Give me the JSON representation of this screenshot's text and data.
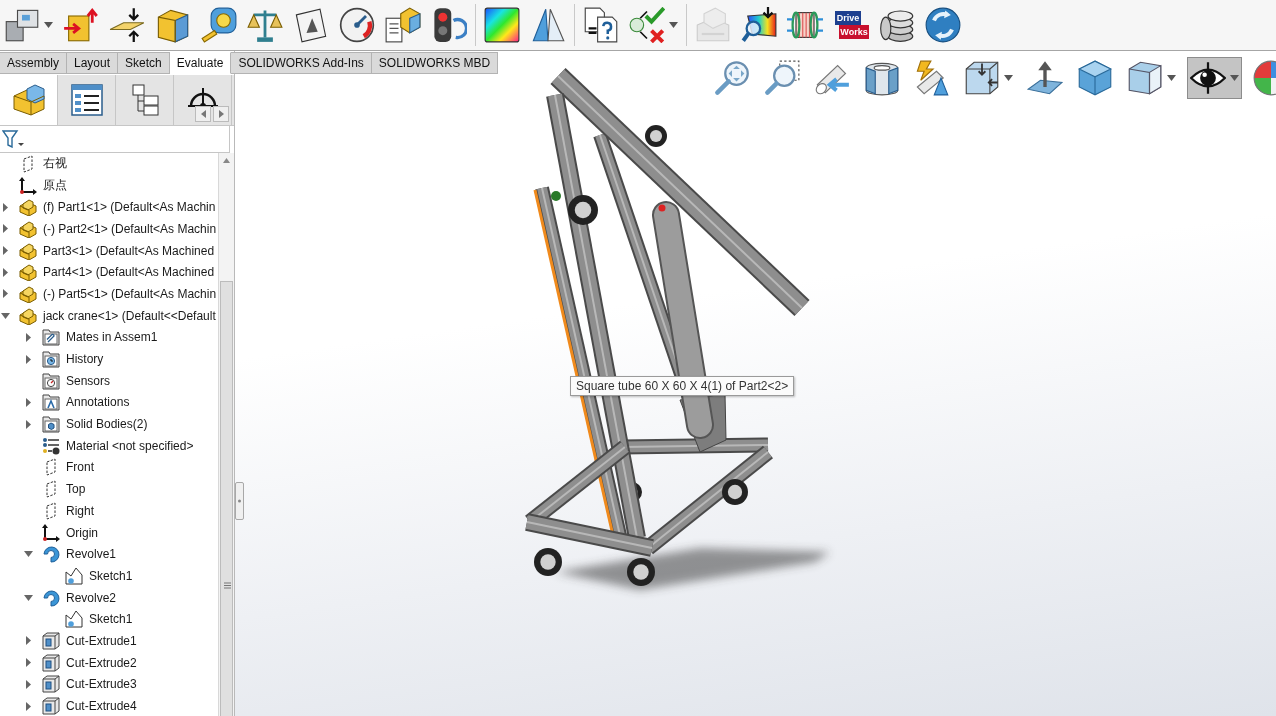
{
  "command_manager": {
    "groups": [
      {
        "buttons": [
          {
            "dropdown": true,
            "disabled": false
          },
          {
            "dropdown": false,
            "disabled": false
          },
          {
            "dropdown": false,
            "disabled": false
          },
          {
            "dropdown": false,
            "disabled": false
          },
          {
            "dropdown": false,
            "disabled": false
          },
          {
            "dropdown": false,
            "disabled": false
          },
          {
            "dropdown": false,
            "disabled": false
          },
          {
            "dropdown": false,
            "disabled": false
          },
          {
            "dropdown": false,
            "disabled": false
          },
          {
            "dropdown": false,
            "disabled": false
          }
        ]
      },
      {
        "buttons": [
          {
            "dropdown": false,
            "disabled": false
          },
          {
            "dropdown": false,
            "disabled": false
          }
        ]
      },
      {
        "buttons": [
          {
            "dropdown": false,
            "disabled": false
          },
          {
            "dropdown": true,
            "disabled": false
          }
        ]
      },
      {
        "buttons": [
          {
            "dropdown": false,
            "disabled": true
          },
          {
            "dropdown": false,
            "disabled": false
          },
          {
            "dropdown": false,
            "disabled": false
          },
          {
            "dropdown": false,
            "disabled": false,
            "label_lines": [
              "Drive",
              "Works"
            ]
          },
          {
            "dropdown": false,
            "disabled": false
          },
          {
            "dropdown": false,
            "disabled": false
          }
        ]
      }
    ]
  },
  "tabs": [
    {
      "label": "Assembly",
      "selected": false
    },
    {
      "label": "Layout",
      "selected": false
    },
    {
      "label": "Sketch",
      "selected": false
    },
    {
      "label": "Evaluate",
      "selected": true
    },
    {
      "label": "SOLIDWORKS Add-Ins",
      "selected": false
    },
    {
      "label": "SOLIDWORKS MBD",
      "selected": false
    }
  ],
  "feature_manager": {
    "tabs": [
      {
        "selected": true
      },
      {
        "selected": false
      },
      {
        "selected": false
      },
      {
        "selected": false
      }
    ],
    "tree": [
      {
        "label": "右视",
        "kind": "plane",
        "expandable": false
      },
      {
        "label": "原点",
        "kind": "origin",
        "expandable": false
      },
      {
        "label": "(f) Part1<1> (Default<As Machin",
        "kind": "part",
        "expandable": true,
        "expanded": false
      },
      {
        "label": "(-) Part2<1> (Default<As Machin",
        "kind": "part",
        "expandable": true,
        "expanded": false
      },
      {
        "label": "Part3<1> (Default<As Machined",
        "kind": "part",
        "expandable": true,
        "expanded": false
      },
      {
        "label": "Part4<1> (Default<As Machined",
        "kind": "part",
        "expandable": true,
        "expanded": false
      },
      {
        "label": "(-) Part5<1> (Default<As Machin",
        "kind": "part",
        "expandable": true,
        "expanded": false
      },
      {
        "label": "jack crane<1> (Default<<Default",
        "kind": "part",
        "expandable": true,
        "expanded": true,
        "children": [
          {
            "label": "Mates in Assem1",
            "kind": "mates-folder",
            "expandable": true,
            "expanded": false
          },
          {
            "label": "History",
            "kind": "history-folder",
            "expandable": true,
            "expanded": false
          },
          {
            "label": "Sensors",
            "kind": "sensors-folder",
            "expandable": false
          },
          {
            "label": "Annotations",
            "kind": "annotations-folder",
            "expandable": true,
            "expanded": false
          },
          {
            "label": "Solid Bodies(2)",
            "kind": "bodies-folder",
            "expandable": true,
            "expanded": false
          },
          {
            "label": "Material <not specified>",
            "kind": "material",
            "expandable": false
          },
          {
            "label": "Front",
            "kind": "plane",
            "expandable": false
          },
          {
            "label": "Top",
            "kind": "plane",
            "expandable": false
          },
          {
            "label": "Right",
            "kind": "plane",
            "expandable": false
          },
          {
            "label": "Origin",
            "kind": "origin",
            "expandable": false
          },
          {
            "label": "Revolve1",
            "kind": "revolve",
            "expandable": true,
            "expanded": true,
            "children": [
              {
                "label": "Sketch1",
                "kind": "sketch",
                "expandable": false
              }
            ]
          },
          {
            "label": "Revolve2",
            "kind": "revolve",
            "expandable": true,
            "expanded": true,
            "children": [
              {
                "label": "Sketch1",
                "kind": "sketch",
                "expandable": false
              }
            ]
          },
          {
            "label": "Cut-Extrude1",
            "kind": "cut-extrude",
            "expandable": true,
            "expanded": false
          },
          {
            "label": "Cut-Extrude2",
            "kind": "cut-extrude",
            "expandable": true,
            "expanded": false
          },
          {
            "label": "Cut-Extrude3",
            "kind": "cut-extrude",
            "expandable": true,
            "expanded": false
          },
          {
            "label": "Cut-Extrude4",
            "kind": "cut-extrude",
            "expandable": true,
            "expanded": false
          }
        ]
      }
    ]
  },
  "graphics_area": {
    "view_toolbar": [
      {
        "dropdown": false,
        "selected": false
      },
      {
        "dropdown": false,
        "selected": false
      },
      {
        "dropdown": false,
        "selected": false
      },
      {
        "dropdown": false,
        "selected": false
      },
      {
        "dropdown": false,
        "selected": false
      },
      {
        "dropdown": true,
        "selected": false
      },
      {
        "dropdown": false,
        "selected": false
      },
      {
        "dropdown": false,
        "selected": false
      },
      {
        "dropdown": true,
        "selected": false
      },
      {
        "dropdown": true,
        "selected": true
      },
      {
        "dropdown": false,
        "selected": false
      }
    ],
    "tooltip": "Square tube 60 X 60 X 4(1) of Part2<2>"
  }
}
